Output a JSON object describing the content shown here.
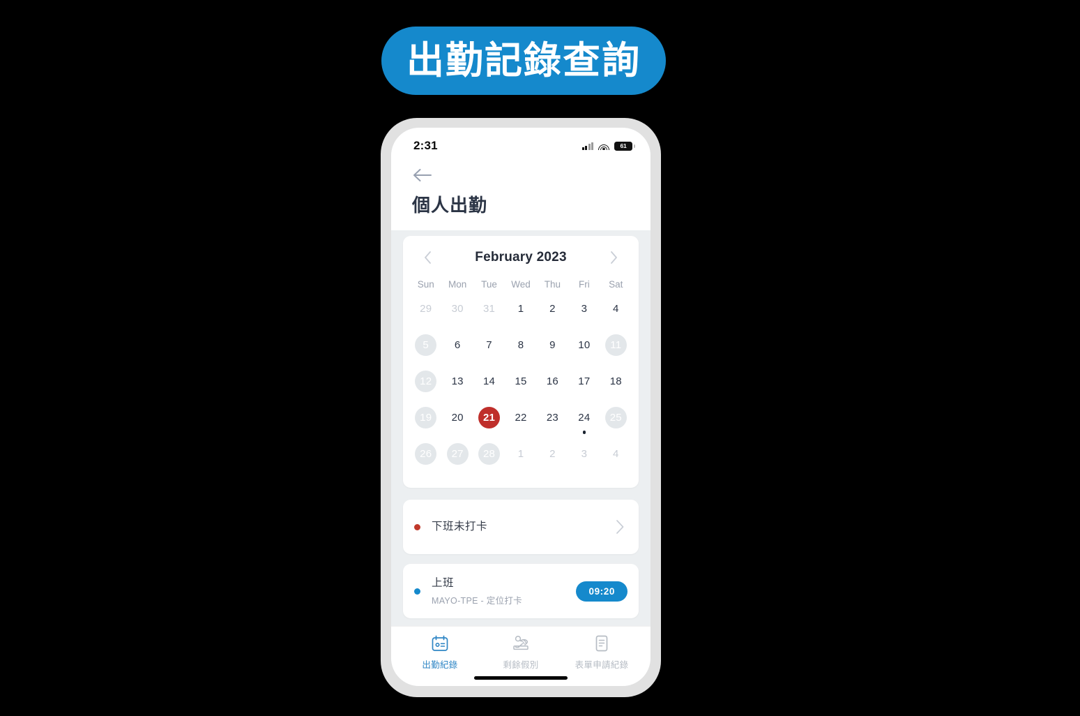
{
  "banner": {
    "title": "出勤記錄查詢",
    "bg_color": "#1589cc",
    "text_color": "#ffffff"
  },
  "status_bar": {
    "time": "2:31",
    "battery_level": "61",
    "signal_icon": "cellular-signal-icon",
    "wifi_icon": "wifi-icon",
    "battery_icon": "battery-icon"
  },
  "header": {
    "back_icon": "back-arrow-icon",
    "title": "個人出勤"
  },
  "calendar": {
    "prev_icon": "chevron-left-icon",
    "next_icon": "chevron-right-icon",
    "month_title": "February 2023",
    "weekdays": [
      "Sun",
      "Mon",
      "Tue",
      "Wed",
      "Thu",
      "Fri",
      "Sat"
    ],
    "selected_day": 21,
    "selected_color": "#bf2f2b",
    "weeks": [
      [
        {
          "label": "29",
          "state": "muted"
        },
        {
          "label": "30",
          "state": "muted"
        },
        {
          "label": "31",
          "state": "muted"
        },
        {
          "label": "1",
          "state": "normal"
        },
        {
          "label": "2",
          "state": "normal"
        },
        {
          "label": "3",
          "state": "normal"
        },
        {
          "label": "4",
          "state": "normal"
        }
      ],
      [
        {
          "label": "5",
          "state": "off"
        },
        {
          "label": "6",
          "state": "normal"
        },
        {
          "label": "7",
          "state": "normal"
        },
        {
          "label": "8",
          "state": "normal"
        },
        {
          "label": "9",
          "state": "normal"
        },
        {
          "label": "10",
          "state": "normal"
        },
        {
          "label": "11",
          "state": "off"
        }
      ],
      [
        {
          "label": "12",
          "state": "off"
        },
        {
          "label": "13",
          "state": "normal"
        },
        {
          "label": "14",
          "state": "normal"
        },
        {
          "label": "15",
          "state": "normal"
        },
        {
          "label": "16",
          "state": "normal"
        },
        {
          "label": "17",
          "state": "normal"
        },
        {
          "label": "18",
          "state": "normal"
        }
      ],
      [
        {
          "label": "19",
          "state": "off"
        },
        {
          "label": "20",
          "state": "normal"
        },
        {
          "label": "21",
          "state": "selected"
        },
        {
          "label": "22",
          "state": "normal"
        },
        {
          "label": "23",
          "state": "normal"
        },
        {
          "label": "24",
          "state": "normal",
          "marker": true
        },
        {
          "label": "25",
          "state": "off"
        }
      ],
      [
        {
          "label": "26",
          "state": "off"
        },
        {
          "label": "27",
          "state": "off"
        },
        {
          "label": "28",
          "state": "off"
        },
        {
          "label": "1",
          "state": "muted"
        },
        {
          "label": "2",
          "state": "muted"
        },
        {
          "label": "3",
          "state": "muted"
        },
        {
          "label": "4",
          "state": "muted"
        }
      ]
    ]
  },
  "records": [
    {
      "dot_color": "red",
      "title": "下班未打卡",
      "subtitle": "",
      "time": "",
      "chevron_icon": "chevron-right-icon"
    },
    {
      "dot_color": "blue",
      "title": "上班",
      "subtitle": "MAYO-TPE - 定位打卡",
      "time": "09:20",
      "chevron_icon": ""
    }
  ],
  "tabs": [
    {
      "label": "出勤紀錄",
      "icon": "calendar-icon",
      "active": true
    },
    {
      "label": "剩餘假別",
      "icon": "beach-umbrella-icon",
      "active": false
    },
    {
      "label": "表單申請紀錄",
      "icon": "document-icon",
      "active": false
    }
  ],
  "home_indicator": "home-indicator"
}
